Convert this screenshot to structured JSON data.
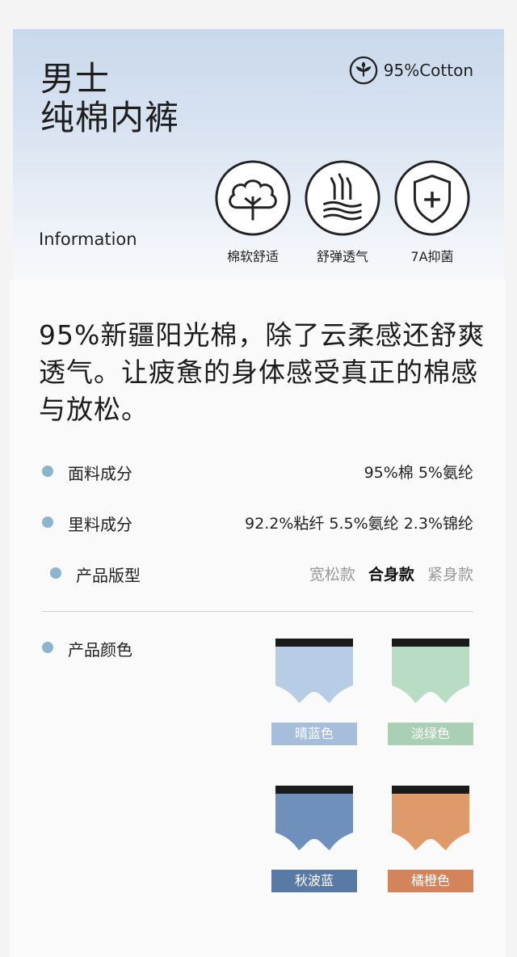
{
  "header": {
    "title_line1": "男士",
    "title_line2": "纯棉内裤",
    "cotton_badge": "95%Cotton",
    "info_label": "Information",
    "features": [
      {
        "icon": "cotton-plant-icon",
        "label": "棉软舒适"
      },
      {
        "icon": "elastic-waves-icon",
        "label": "舒弹透气"
      },
      {
        "icon": "shield-plus-icon",
        "label": "7A抑菌"
      }
    ]
  },
  "main": {
    "lead_text": "95%新疆阳光棉，除了云柔感还舒爽透气。让疲惫的身体感受真正的棉感与放松。",
    "specs": [
      {
        "label": "面料成分",
        "value": "95%棉 5%氨纶"
      },
      {
        "label": "里料成分",
        "value": "92.2%粘纤  5.5%氨纶 2.3%锦纶"
      }
    ],
    "fit": {
      "label": "产品版型",
      "options": [
        "宽松款",
        "合身款",
        "紧身款"
      ],
      "selected": "合身款"
    },
    "colors": {
      "label": "产品颜色",
      "items": [
        {
          "name": "晴蓝色",
          "body": "#b7cde6",
          "tag": "#a6bedc"
        },
        {
          "name": "淡绿色",
          "body": "#b9dcc4",
          "tag": "#a9cfb4"
        },
        {
          "name": "秋波蓝",
          "body": "#6f90bb",
          "tag": "#5a7aa6"
        },
        {
          "name": "橘橙色",
          "body": "#df9a6c",
          "tag": "#d4845a"
        }
      ]
    }
  }
}
